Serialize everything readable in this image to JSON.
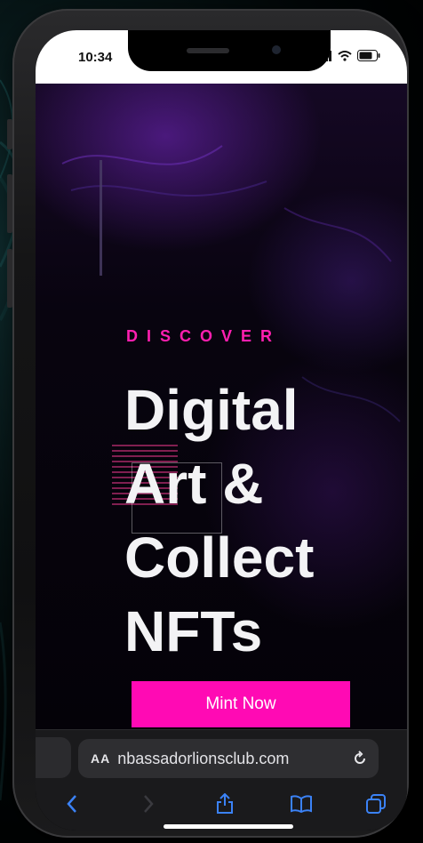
{
  "status_bar": {
    "time": "10:34",
    "icons": [
      "signal-icon",
      "wifi-icon",
      "battery-icon"
    ]
  },
  "hero": {
    "eyebrow": "DISCOVER",
    "headline": "Digital\nArt &\nCollect\nNFTs",
    "cta_label": "Mint Now"
  },
  "browser": {
    "text_size_label": "AA",
    "url": "nbassadorlionsclub.com",
    "toolbar_icons": [
      "back-icon",
      "forward-icon",
      "share-icon",
      "bookmarks-icon",
      "tabs-icon"
    ]
  },
  "colors": {
    "accent": "#ff0ab4",
    "eyebrow": "#ff1fb0",
    "browser_icon": "#3b82f6"
  }
}
